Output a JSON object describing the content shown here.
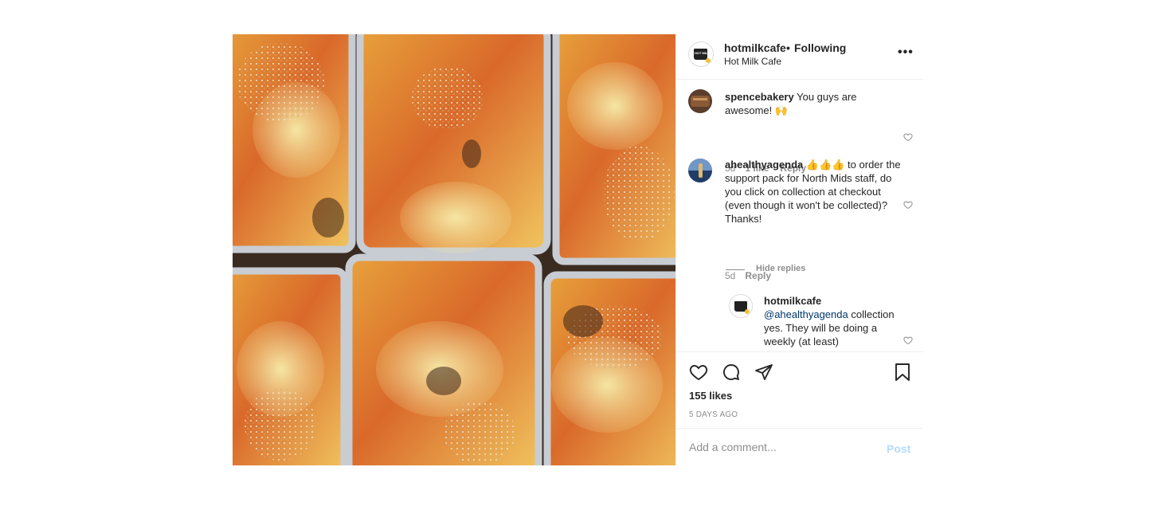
{
  "header": {
    "username": "hotmilkcafe",
    "separator": "•",
    "follow_status": "Following",
    "subtitle": "Hot Milk Cafe",
    "more_icon": "more-options-icon",
    "avatar_logo_text": "HOT MILK"
  },
  "comments": [
    {
      "username": "spencebakery",
      "text": "You guys are awesome! 🙌",
      "time": "5d",
      "likes_label": "1 like",
      "reply_label": "Reply"
    },
    {
      "username": "ahealthyagenda",
      "text": "👍👍👍 to order the support pack for North Mids staff, do you click on collection at checkout (even though it won't be collected)? Thanks!",
      "time": "5d",
      "reply_label": "Reply"
    }
  ],
  "hide_replies_label": "Hide replies",
  "reply": {
    "username": "hotmilkcafe",
    "mention": "@ahealthyagenda",
    "text": "collection yes. They will be doing a weekly (at least)"
  },
  "actions": {
    "like_icon": "heart-icon",
    "comment_icon": "comment-icon",
    "share_icon": "share-icon",
    "save_icon": "bookmark-icon"
  },
  "likes": "155 likes",
  "date": "5 DAYS AGO",
  "add_comment": {
    "placeholder": "Add a comment...",
    "post_label": "Post"
  },
  "colors": {
    "text": "#262626",
    "secondary": "#8e8e8e",
    "link": "#00376b",
    "post_disabled": "#b3dbff",
    "border": "#efefef"
  }
}
